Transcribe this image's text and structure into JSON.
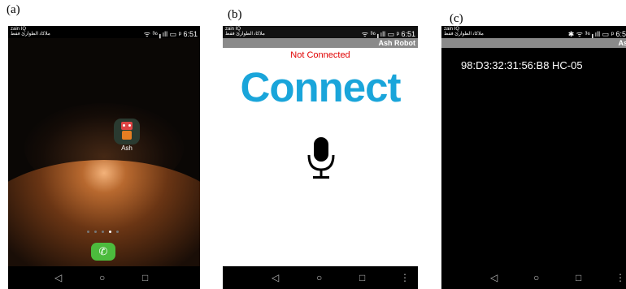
{
  "panels": {
    "a": {
      "label": "(a)",
      "status": {
        "carrier_line1": "zain IQ",
        "carrier_line2": "ﻣﻠﺎﻛﺎﺗ ﺍﻟﻄﻮﺍﺭﺉ ﻓﻘﻂ",
        "right": "ᯤ ³⁶╻ıll ▭ ᵖ 6:51"
      },
      "app_icon": {
        "name": "robot-icon",
        "label": "Ash"
      },
      "page_dots": {
        "count": 5,
        "active": 3
      },
      "dock": {
        "icon": "phone-icon",
        "glyph": "✆"
      },
      "nav": {
        "back": "◁",
        "home": "○",
        "recent": "□"
      }
    },
    "b": {
      "label": "(b)",
      "status": {
        "carrier_line1": "zain IQ",
        "carrier_line2": "ﻣﻠﺎﻛﺎﺗ ﺍﻟﻄﻮﺍﺭﺉ ﻓﻘﻂ",
        "right": "ᯤ ³⁶╻ıll ▭ ᵖ 6:51"
      },
      "app_title": "Ash Robot",
      "connection_status": "Not Connected",
      "connect_button": "Connect",
      "mic": {
        "name": "microphone-icon"
      },
      "nav": {
        "back": "◁",
        "home": "○",
        "recent": "□",
        "menu": "⋮"
      }
    },
    "c": {
      "label": "(c)",
      "status": {
        "carrier_line1": "zain IQ",
        "carrier_line2": "ﻣﻠﺎﻛﺎﺗ ﺍﻟﻄﻮﺍﺭﺉ ﻓﻘﻂ",
        "right": "✱ ᯤ ³⁶╻ıll ▭ ᵖ 6:5"
      },
      "app_title": "As",
      "device": "98:D3:32:31:56:B8 HC-05",
      "nav": {
        "back": "◁",
        "home": "○",
        "recent": "□",
        "menu": "⋮"
      }
    }
  },
  "colors": {
    "connect_blue": "#1aa5da",
    "error_red": "#e00000",
    "dock_green": "#4cbb3d",
    "titlebar_gray": "#8a8a8a"
  }
}
